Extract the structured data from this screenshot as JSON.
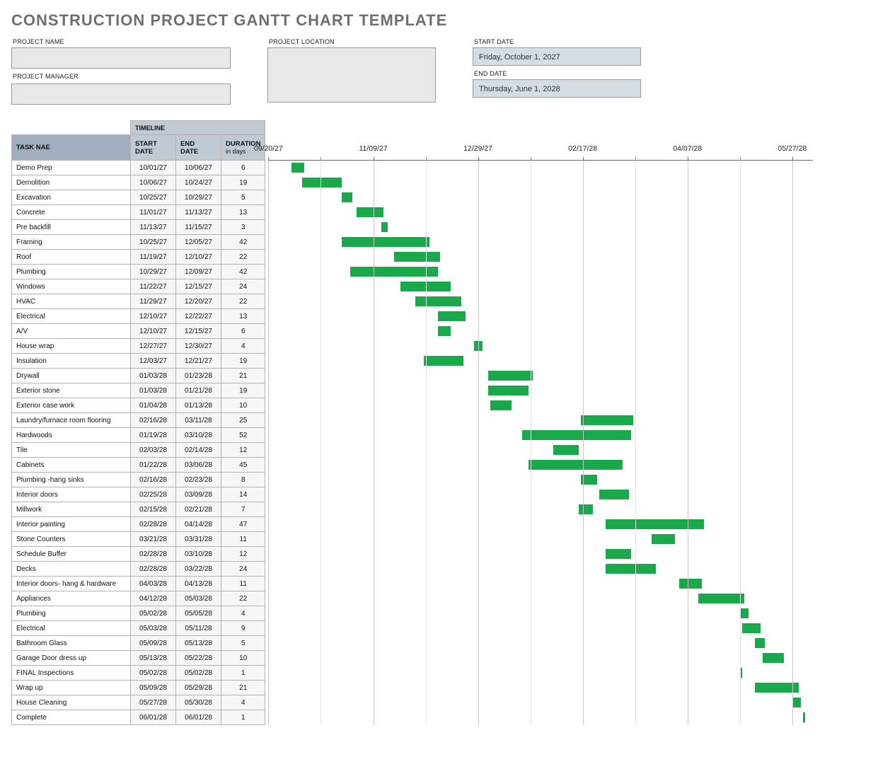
{
  "header": {
    "title": "CONSTRUCTION PROJECT GANTT CHART TEMPLATE"
  },
  "fields": {
    "project_name_label": "PROJECT NAME",
    "project_manager_label": "PROJECT MANAGER",
    "project_location_label": "PROJECT LOCATION",
    "start_date_label": "START DATE",
    "end_date_label": "END DATE",
    "project_name_value": "",
    "project_manager_value": "",
    "project_location_value": "",
    "start_date_value": "Friday, October 1, 2027",
    "end_date_value": "Thursday, June 1, 2028"
  },
  "columns": {
    "timeline_header": "TIMELINE",
    "task_header": "TASK NAE",
    "start_header_l1": "START",
    "start_header_l2": "DATE",
    "end_header_l1": "END",
    "end_header_l2": "DATE",
    "duration_header_l1": "DURATION",
    "duration_header_l2": "in days"
  },
  "axis_ticks": [
    "09/20/27",
    "11/09/27",
    "12/29/27",
    "02/17/28",
    "04/07/28",
    "05/27/28"
  ],
  "tasks": [
    {
      "name": "Demo Prep",
      "start": "10/01/27",
      "end": "10/06/27",
      "dur": 6
    },
    {
      "name": "Demolition",
      "start": "10/06/27",
      "end": "10/24/27",
      "dur": 19
    },
    {
      "name": "Excavation",
      "start": "10/25/27",
      "end": "10/29/27",
      "dur": 5
    },
    {
      "name": "Concrete",
      "start": "11/01/27",
      "end": "11/13/27",
      "dur": 13
    },
    {
      "name": "Pre backfill",
      "start": "11/13/27",
      "end": "11/15/27",
      "dur": 3
    },
    {
      "name": "Framing",
      "start": "10/25/27",
      "end": "12/05/27",
      "dur": 42
    },
    {
      "name": "Roof",
      "start": "11/19/27",
      "end": "12/10/27",
      "dur": 22
    },
    {
      "name": "Plumbing",
      "start": "10/29/27",
      "end": "12/09/27",
      "dur": 42
    },
    {
      "name": "Windows",
      "start": "11/22/27",
      "end": "12/15/27",
      "dur": 24
    },
    {
      "name": "HVAC",
      "start": "11/29/27",
      "end": "12/20/27",
      "dur": 22
    },
    {
      "name": "Electrical",
      "start": "12/10/27",
      "end": "12/22/27",
      "dur": 13
    },
    {
      "name": "A/V",
      "start": "12/10/27",
      "end": "12/15/27",
      "dur": 6
    },
    {
      "name": "House wrap",
      "start": "12/27/27",
      "end": "12/30/27",
      "dur": 4
    },
    {
      "name": "Insulation",
      "start": "12/03/27",
      "end": "12/21/27",
      "dur": 19
    },
    {
      "name": "Drywall",
      "start": "01/03/28",
      "end": "01/23/28",
      "dur": 21
    },
    {
      "name": "Exterior stone",
      "start": "01/03/28",
      "end": "01/21/28",
      "dur": 19
    },
    {
      "name": "Exterior case work",
      "start": "01/04/28",
      "end": "01/13/28",
      "dur": 10
    },
    {
      "name": "Laundry/furnace room flooring",
      "start": "02/16/28",
      "end": "03/11/28",
      "dur": 25
    },
    {
      "name": "Hardwoods",
      "start": "01/19/28",
      "end": "03/10/28",
      "dur": 52
    },
    {
      "name": "Tile",
      "start": "02/03/28",
      "end": "02/14/28",
      "dur": 12
    },
    {
      "name": "Cabinets",
      "start": "01/22/28",
      "end": "03/06/28",
      "dur": 45
    },
    {
      "name": "Plumbing -hang sinks",
      "start": "02/16/28",
      "end": "02/23/28",
      "dur": 8
    },
    {
      "name": "Interior doors",
      "start": "02/25/28",
      "end": "03/09/28",
      "dur": 14
    },
    {
      "name": "Millwork",
      "start": "02/15/28",
      "end": "02/21/28",
      "dur": 7
    },
    {
      "name": "Interior painting",
      "start": "02/28/28",
      "end": "04/14/28",
      "dur": 47
    },
    {
      "name": "Stone Counters",
      "start": "03/21/28",
      "end": "03/31/28",
      "dur": 11
    },
    {
      "name": "Schedule Buffer",
      "start": "02/28/28",
      "end": "03/10/28",
      "dur": 12
    },
    {
      "name": "Decks",
      "start": "02/28/28",
      "end": "03/22/28",
      "dur": 24
    },
    {
      "name": "Interior doors- hang & hardware",
      "start": "04/03/28",
      "end": "04/13/28",
      "dur": 11
    },
    {
      "name": "Appliances",
      "start": "04/12/28",
      "end": "05/03/28",
      "dur": 22
    },
    {
      "name": "Plumbing",
      "start": "05/02/28",
      "end": "05/05/28",
      "dur": 4
    },
    {
      "name": "Electrical",
      "start": "05/03/28",
      "end": "05/11/28",
      "dur": 9
    },
    {
      "name": "Bathroom Glass",
      "start": "05/09/28",
      "end": "05/13/28",
      "dur": 5
    },
    {
      "name": "Garage Door dress up",
      "start": "05/13/28",
      "end": "05/22/28",
      "dur": 10
    },
    {
      "name": "FINAL Inspections",
      "start": "05/02/28",
      "end": "05/02/28",
      "dur": 1
    },
    {
      "name": "Wrap up",
      "start": "05/09/28",
      "end": "05/29/28",
      "dur": 21
    },
    {
      "name": "House Cleaning",
      "start": "05/27/28",
      "end": "05/30/28",
      "dur": 4
    },
    {
      "name": "Complete",
      "start": "06/01/28",
      "end": "06/01/28",
      "dur": 1
    }
  ],
  "chart_data": {
    "type": "gantt",
    "title": "Construction Project Gantt Chart",
    "x_axis_dates": [
      "09/20/27",
      "11/09/27",
      "12/29/27",
      "02/17/28",
      "04/07/28",
      "05/27/28"
    ],
    "x_axis_range_days": {
      "start": "2027-09-20",
      "end": "2028-06-01"
    },
    "bar_color": "#19a84a",
    "series": [
      {
        "name": "Demo Prep",
        "start": "2027-10-01",
        "end": "2027-10-06",
        "duration_days": 6
      },
      {
        "name": "Demolition",
        "start": "2027-10-06",
        "end": "2027-10-24",
        "duration_days": 19
      },
      {
        "name": "Excavation",
        "start": "2027-10-25",
        "end": "2027-10-29",
        "duration_days": 5
      },
      {
        "name": "Concrete",
        "start": "2027-11-01",
        "end": "2027-11-13",
        "duration_days": 13
      },
      {
        "name": "Pre backfill",
        "start": "2027-11-13",
        "end": "2027-11-15",
        "duration_days": 3
      },
      {
        "name": "Framing",
        "start": "2027-10-25",
        "end": "2027-12-05",
        "duration_days": 42
      },
      {
        "name": "Roof",
        "start": "2027-11-19",
        "end": "2027-12-10",
        "duration_days": 22
      },
      {
        "name": "Plumbing",
        "start": "2027-10-29",
        "end": "2027-12-09",
        "duration_days": 42
      },
      {
        "name": "Windows",
        "start": "2027-11-22",
        "end": "2027-12-15",
        "duration_days": 24
      },
      {
        "name": "HVAC",
        "start": "2027-11-29",
        "end": "2027-12-20",
        "duration_days": 22
      },
      {
        "name": "Electrical",
        "start": "2027-12-10",
        "end": "2027-12-22",
        "duration_days": 13
      },
      {
        "name": "A/V",
        "start": "2027-12-10",
        "end": "2027-12-15",
        "duration_days": 6
      },
      {
        "name": "House wrap",
        "start": "2027-12-27",
        "end": "2027-12-30",
        "duration_days": 4
      },
      {
        "name": "Insulation",
        "start": "2027-12-03",
        "end": "2027-12-21",
        "duration_days": 19
      },
      {
        "name": "Drywall",
        "start": "2028-01-03",
        "end": "2028-01-23",
        "duration_days": 21
      },
      {
        "name": "Exterior stone",
        "start": "2028-01-03",
        "end": "2028-01-21",
        "duration_days": 19
      },
      {
        "name": "Exterior case work",
        "start": "2028-01-04",
        "end": "2028-01-13",
        "duration_days": 10
      },
      {
        "name": "Laundry/furnace room flooring",
        "start": "2028-02-16",
        "end": "2028-03-11",
        "duration_days": 25
      },
      {
        "name": "Hardwoods",
        "start": "2028-01-19",
        "end": "2028-03-10",
        "duration_days": 52
      },
      {
        "name": "Tile",
        "start": "2028-02-03",
        "end": "2028-02-14",
        "duration_days": 12
      },
      {
        "name": "Cabinets",
        "start": "2028-01-22",
        "end": "2028-03-06",
        "duration_days": 45
      },
      {
        "name": "Plumbing -hang sinks",
        "start": "2028-02-16",
        "end": "2028-02-23",
        "duration_days": 8
      },
      {
        "name": "Interior doors",
        "start": "2028-02-25",
        "end": "2028-03-09",
        "duration_days": 14
      },
      {
        "name": "Millwork",
        "start": "2028-02-15",
        "end": "2028-02-21",
        "duration_days": 7
      },
      {
        "name": "Interior painting",
        "start": "2028-02-28",
        "end": "2028-04-14",
        "duration_days": 47
      },
      {
        "name": "Stone Counters",
        "start": "2028-03-21",
        "end": "2028-03-31",
        "duration_days": 11
      },
      {
        "name": "Schedule Buffer",
        "start": "2028-02-28",
        "end": "2028-03-10",
        "duration_days": 12
      },
      {
        "name": "Decks",
        "start": "2028-02-28",
        "end": "2028-03-22",
        "duration_days": 24
      },
      {
        "name": "Interior doors- hang & hardware",
        "start": "2028-04-03",
        "end": "2028-04-13",
        "duration_days": 11
      },
      {
        "name": "Appliances",
        "start": "2028-04-12",
        "end": "2028-05-03",
        "duration_days": 22
      },
      {
        "name": "Plumbing",
        "start": "2028-05-02",
        "end": "2028-05-05",
        "duration_days": 4
      },
      {
        "name": "Electrical",
        "start": "2028-05-03",
        "end": "2028-05-11",
        "duration_days": 9
      },
      {
        "name": "Bathroom Glass",
        "start": "2028-05-09",
        "end": "2028-05-13",
        "duration_days": 5
      },
      {
        "name": "Garage Door dress up",
        "start": "2028-05-13",
        "end": "2028-05-22",
        "duration_days": 10
      },
      {
        "name": "FINAL Inspections",
        "start": "2028-05-02",
        "end": "2028-05-02",
        "duration_days": 1
      },
      {
        "name": "Wrap up",
        "start": "2028-05-09",
        "end": "2028-05-29",
        "duration_days": 21
      },
      {
        "name": "House Cleaning",
        "start": "2028-05-27",
        "end": "2028-05-30",
        "duration_days": 4
      },
      {
        "name": "Complete",
        "start": "2028-06-01",
        "end": "2028-06-01",
        "duration_days": 1
      }
    ]
  }
}
